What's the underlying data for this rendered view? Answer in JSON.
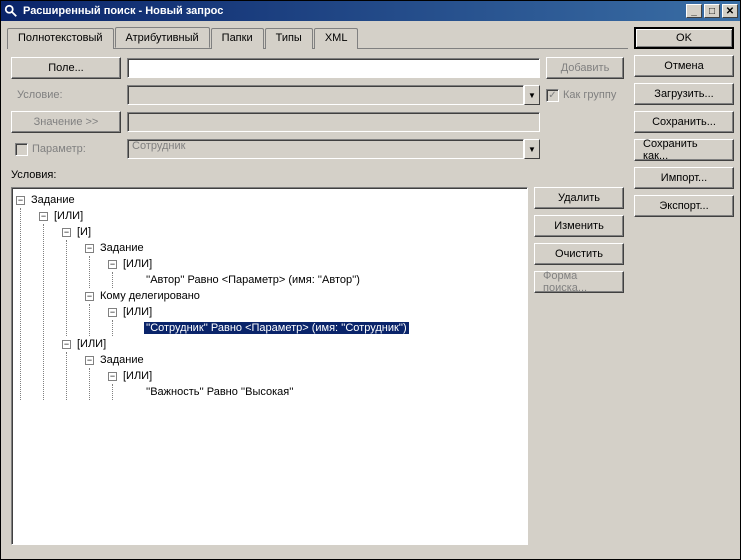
{
  "title": "Расширенный поиск - Новый запрос",
  "tabs": [
    "Полнотекстовый",
    "Атрибутивный",
    "Папки",
    "Типы",
    "XML"
  ],
  "active_tab": 1,
  "field_button": "Поле...",
  "condition_label": "Условие:",
  "value_button": "Значение >>",
  "parameter_checkbox": "Параметр:",
  "parameter_value": "Сотрудник",
  "add_button": "Добавить",
  "as_group_checkbox": "Как группу",
  "conditions_label": "Условия:",
  "tree_buttons": {
    "delete": "Удалить",
    "edit": "Изменить",
    "clear": "Очистить",
    "form": "Форма поиска..."
  },
  "side_buttons": {
    "ok": "OK",
    "cancel": "Отмена",
    "load": "Загрузить...",
    "save": "Сохранить...",
    "save_as": "Сохранить как...",
    "import": "Импорт...",
    "export": "Экспорт..."
  },
  "tree": {
    "n0": "Задание",
    "n1": "[ИЛИ]",
    "n2": "[И]",
    "n3": "Задание",
    "n4": "[ИЛИ]",
    "n5": "''Автор'' Равно <Параметр> (имя: ''Автор'')",
    "n6": "Кому делегировано",
    "n7": "[ИЛИ]",
    "n8": "''Сотрудник'' Равно <Параметр> (имя: ''Сотрудник'')",
    "n9": "[ИЛИ]",
    "n10": "Задание",
    "n11": "[ИЛИ]",
    "n12": "''Важность'' Равно ''Высокая''"
  }
}
